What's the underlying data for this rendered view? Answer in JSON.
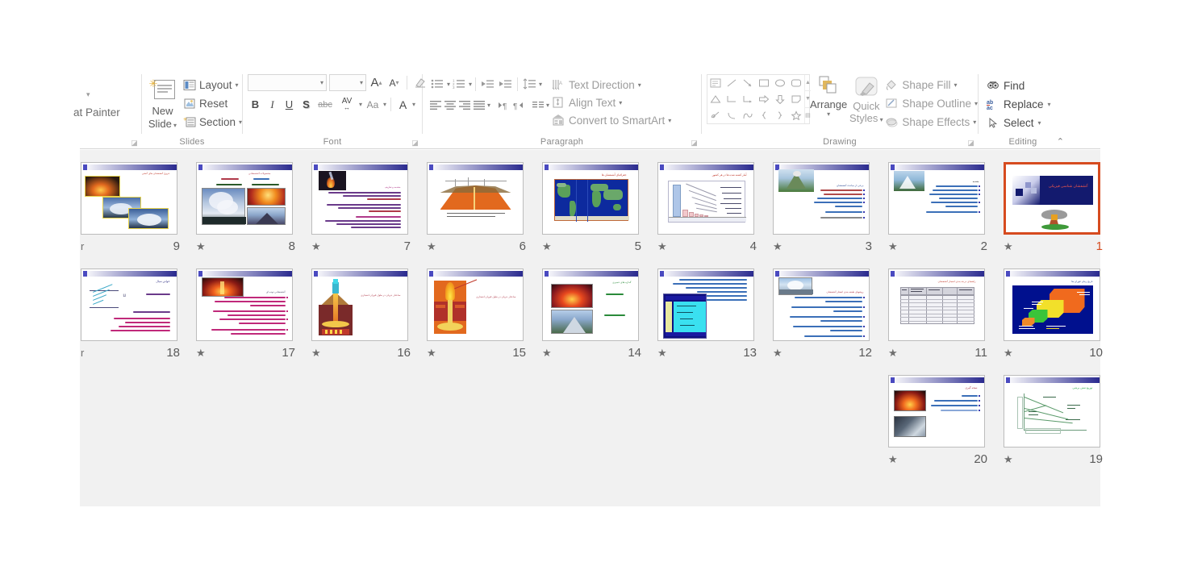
{
  "app": {
    "name": "Microsoft PowerPoint",
    "view": "Slide Sorter"
  },
  "ribbon": {
    "groups": [
      {
        "name": "clipboard",
        "label": "",
        "format_painter_label": "at Painter"
      },
      {
        "name": "slides",
        "label": "Slides",
        "new_slide_label_line1": "New",
        "new_slide_label_line2": "Slide",
        "buttons": [
          {
            "id": "layout",
            "label": "Layout",
            "icon": "layout-icon",
            "has_caret": true
          },
          {
            "id": "reset",
            "label": "Reset",
            "icon": "reset-icon",
            "has_caret": false
          },
          {
            "id": "section",
            "label": "Section",
            "icon": "section-icon",
            "has_caret": true
          }
        ]
      },
      {
        "name": "font",
        "label": "Font",
        "font_family_value": "",
        "font_family_placeholder": "",
        "font_size_value": "",
        "font_size_placeholder": "",
        "buttons": [
          {
            "id": "grow-font",
            "label": "A",
            "icon": "increase-font-size-icon"
          },
          {
            "id": "shrink-font",
            "label": "A",
            "icon": "decrease-font-size-icon"
          },
          {
            "id": "clear-formatting",
            "label": "",
            "icon": "clear-formatting-icon"
          },
          {
            "id": "bold",
            "label": "B",
            "icon": "bold-icon"
          },
          {
            "id": "italic",
            "label": "I",
            "icon": "italic-icon"
          },
          {
            "id": "underline",
            "label": "U",
            "icon": "underline-icon"
          },
          {
            "id": "shadow",
            "label": "S",
            "icon": "text-shadow-icon"
          },
          {
            "id": "strikethrough",
            "label": "abc",
            "icon": "strikethrough-icon"
          },
          {
            "id": "character-spacing",
            "label": "AV",
            "icon": "character-spacing-icon"
          },
          {
            "id": "change-case",
            "label": "Aa",
            "icon": "change-case-icon"
          },
          {
            "id": "font-color",
            "label": "A",
            "icon": "font-color-icon"
          }
        ]
      },
      {
        "name": "paragraph",
        "label": "Paragraph",
        "buttons": [
          {
            "id": "bullets",
            "icon": "bullets-icon"
          },
          {
            "id": "numbering",
            "icon": "numbering-icon"
          },
          {
            "id": "decrease-indent",
            "icon": "decrease-indent-icon"
          },
          {
            "id": "increase-indent",
            "icon": "increase-indent-icon"
          },
          {
            "id": "line-spacing",
            "icon": "line-spacing-icon"
          },
          {
            "id": "align-left",
            "icon": "align-left-icon"
          },
          {
            "id": "align-center",
            "icon": "align-center-icon"
          },
          {
            "id": "align-right",
            "icon": "align-right-icon"
          },
          {
            "id": "justify",
            "icon": "justify-icon"
          },
          {
            "id": "ltr-text-direction",
            "icon": "ltr-icon"
          },
          {
            "id": "rtl-text-direction",
            "icon": "rtl-icon"
          },
          {
            "id": "columns",
            "icon": "columns-icon"
          }
        ],
        "menu_items": [
          {
            "id": "text-direction",
            "label": "Text Direction",
            "icon": "text-direction-icon",
            "has_caret": true
          },
          {
            "id": "align-text",
            "label": "Align Text",
            "icon": "align-text-icon",
            "has_caret": true
          },
          {
            "id": "convert-to-smartart",
            "label": "Convert to SmartArt",
            "icon": "smartart-icon",
            "has_caret": true
          }
        ]
      },
      {
        "name": "drawing",
        "label": "Drawing",
        "arrange_label": "Arrange",
        "quick_styles_label_line1": "Quick",
        "quick_styles_label_line2": "Styles",
        "menu_items": [
          {
            "id": "shape-fill",
            "label": "Shape Fill",
            "icon": "shape-fill-icon",
            "has_caret": true
          },
          {
            "id": "shape-outline",
            "label": "Shape Outline",
            "icon": "shape-outline-icon",
            "has_caret": true
          },
          {
            "id": "shape-effects",
            "label": "Shape Effects",
            "icon": "shape-effects-icon",
            "has_caret": true
          }
        ]
      },
      {
        "name": "editing",
        "label": "Editing",
        "menu_items": [
          {
            "id": "find",
            "label": "Find",
            "icon": "find-icon",
            "has_caret": false
          },
          {
            "id": "replace",
            "label": "Replace",
            "icon": "replace-icon",
            "has_caret": true
          },
          {
            "id": "select",
            "label": "Select",
            "icon": "select-icon",
            "has_caret": true
          }
        ]
      }
    ],
    "collapse_icon": "chevron-up-icon"
  },
  "sorter": {
    "selected_slide": 1,
    "total_slides": 20,
    "animation_marker": "★",
    "slides": [
      {
        "number": "1",
        "title": "آتشفشان شناسی فیزیکی",
        "kind": "title",
        "animated": true,
        "selected": true
      },
      {
        "number": "2",
        "title": "مقدمه",
        "kind": "image-bullets",
        "animated": true,
        "selected": false
      },
      {
        "number": "3",
        "title": "برخی از مباحث آتشفشان",
        "kind": "image-bullets",
        "animated": true,
        "selected": false
      },
      {
        "number": "4",
        "title": "آمار کشته شده ها در هر کشور",
        "kind": "chart",
        "animated": true,
        "selected": false
      },
      {
        "number": "5",
        "title": "جغرافیای آتشفشان ها",
        "kind": "map",
        "animated": true,
        "selected": false
      },
      {
        "number": "6",
        "title": "",
        "kind": "diagram",
        "animated": true,
        "selected": false
      },
      {
        "number": "7",
        "title": "مقدمه و تعاریف",
        "kind": "image-text",
        "animated": true,
        "selected": false
      },
      {
        "number": "8",
        "title": "محصولات آتشفشانی",
        "kind": "photo-grid",
        "animated": true,
        "selected": false
      },
      {
        "number": "9",
        "title": "خروج آتشفشان های آتشی",
        "kind": "photo-collage",
        "animated": false,
        "selected": false
      },
      {
        "number": "10",
        "title": "تاریخ زمان فوران ها",
        "kind": "dark-diagram",
        "animated": true,
        "selected": false
      },
      {
        "number": "11",
        "title": "راهنمای درجه بندی انفجار آتشفشان",
        "kind": "table",
        "animated": true,
        "selected": false
      },
      {
        "number": "12",
        "title": "روشهای طبقه بندی انفجار آتشفشان",
        "kind": "image-bullets",
        "animated": true,
        "selected": false
      },
      {
        "number": "13",
        "title": "",
        "kind": "dark-screen",
        "animated": true,
        "selected": false
      },
      {
        "number": "14",
        "title": "گدازه های خمیری",
        "kind": "two-photos",
        "animated": true,
        "selected": false
      },
      {
        "number": "15",
        "title": "ساختار جریان در طول قوران انفجاری",
        "kind": "cutaway",
        "animated": true,
        "selected": false
      },
      {
        "number": "16",
        "title": "ساختار جریان در طول قوران انفجاری",
        "kind": "cutaway2",
        "animated": true,
        "selected": false
      },
      {
        "number": "17",
        "title": "آتشفشانی توده ای",
        "kind": "image-bullets",
        "animated": true,
        "selected": false
      },
      {
        "number": "18",
        "title": "خواص سیال",
        "kind": "formula",
        "animated": false,
        "selected": false
      },
      {
        "number": "19",
        "title": "توزیع تنش برشی",
        "kind": "line-chart",
        "animated": true,
        "selected": false
      },
      {
        "number": "20",
        "title": "نتیجه گیری",
        "kind": "image-bullets",
        "animated": true,
        "selected": false
      }
    ]
  },
  "colors": {
    "selection": "#d64b1f",
    "sorter_background": "#f1f1f1",
    "ribbon_background": "#ffffff",
    "slide_title_text": "#c0392b",
    "accent_navy": "#2a2a8f",
    "disabled_text": "#9c9c9c"
  }
}
